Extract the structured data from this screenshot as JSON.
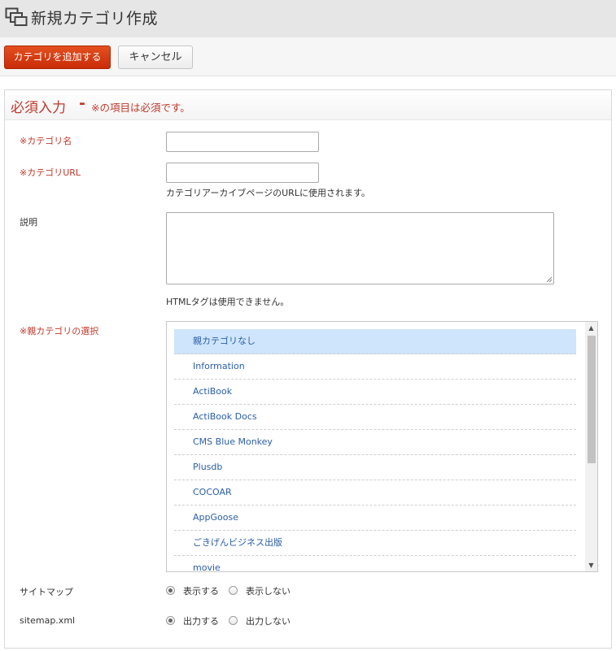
{
  "header": {
    "title": "新規カテゴリ作成",
    "icon": "windows-icon"
  },
  "toolbar": {
    "add_label": "カテゴリを追加する",
    "cancel_label": "キャンセル"
  },
  "panel": {
    "heading": "必須入力",
    "dash": "-",
    "subheading": "※の項目は必須です。"
  },
  "form": {
    "name_label": "※カテゴリ名",
    "name_value": "",
    "url_label": "※カテゴリURL",
    "url_value": "",
    "url_hint": "カテゴリアーカイブページのURLに使用されます。",
    "description_label": "説明",
    "description_value": "",
    "description_hint": "HTMLタグは使用できません。",
    "parent_label": "※親カテゴリの選択",
    "parent_options": [
      "親カテゴリなし",
      "Information",
      "ActiBook",
      "ActiBook Docs",
      "CMS Blue Monkey",
      "Plusdb",
      "COCOAR",
      "AppGoose",
      "ごきげんビジネス出版",
      "movie"
    ],
    "parent_selected": "親カテゴリなし",
    "sitemap_label": "サイトマップ",
    "sitemap_options": [
      "表示する",
      "表示しない"
    ],
    "sitemap_selected": "表示する",
    "sitemapxml_label": "sitemap.xml",
    "sitemapxml_options": [
      "出力する",
      "出力しない"
    ],
    "sitemapxml_selected": "出力する"
  },
  "colors": {
    "accent": "#c0392b",
    "primary_button": "#d63b12",
    "link": "#2a5ea8",
    "selected_row": "#cfe5fb"
  }
}
